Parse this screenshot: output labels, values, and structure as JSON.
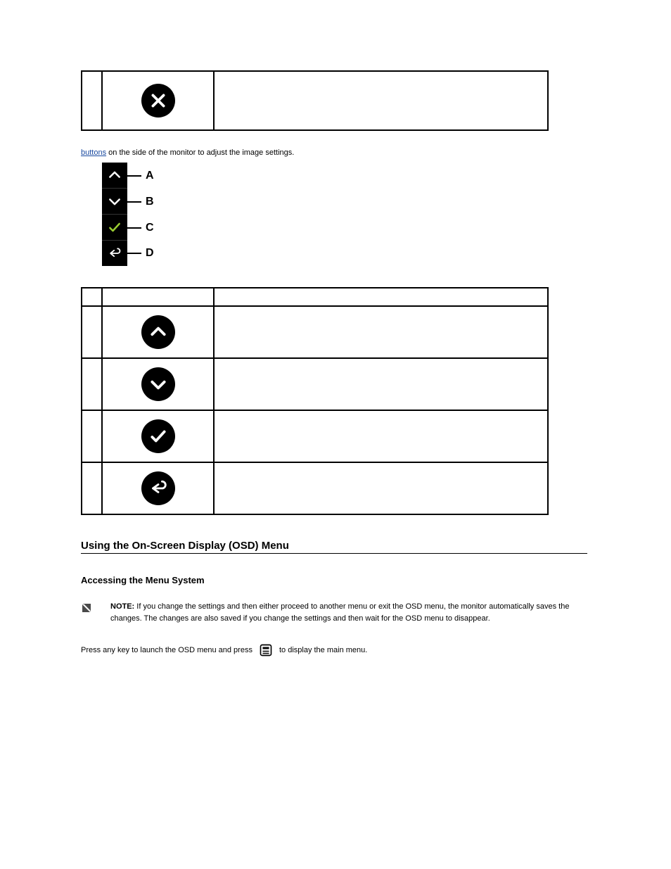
{
  "intro": {
    "prefix_link": "buttons",
    "suffix": " on the side of the monitor to adjust the image settings."
  },
  "panel_labels": [
    "A",
    "B",
    "C",
    "D"
  ],
  "section_title": "Using the On-Screen Display (OSD) Menu",
  "subsection_title": "Accessing the Menu System",
  "note": {
    "label": "NOTE:",
    "text": "If you change the settings and then either proceed to another menu or exit the OSD menu, the monitor automatically saves the changes. The changes are also saved if you change the settings and then wait for the OSD menu to disappear."
  },
  "step1": {
    "text_before": "Press any key to launch the OSD menu and press",
    "text_after": "to display the main menu."
  }
}
